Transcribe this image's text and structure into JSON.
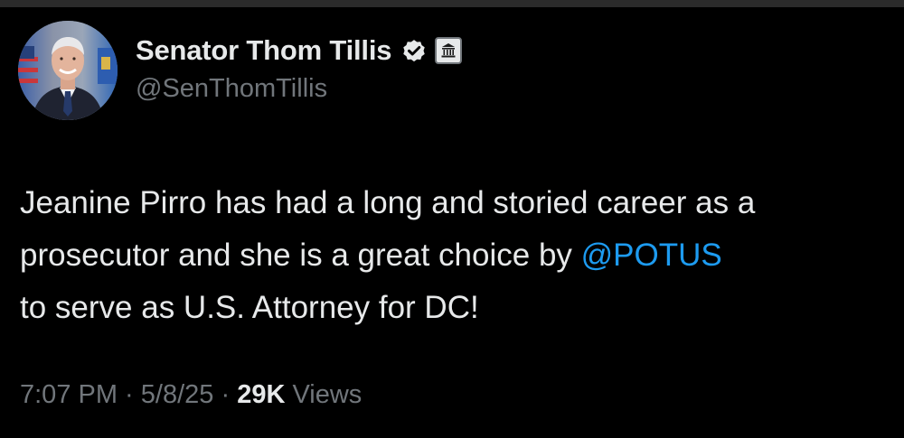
{
  "colors": {
    "background": "#000000",
    "text_primary": "#e7e9ea",
    "text_secondary": "#71767b",
    "mention": "#1d9bf0",
    "verified_badge": "#e7e9ea"
  },
  "author": {
    "display_name": "Senator Thom Tillis",
    "handle": "@SenThomTillis",
    "avatar_icon": "profile-photo",
    "verified_icon": "verified-badge-icon",
    "affiliation_icon": "government-building-icon"
  },
  "tweet": {
    "line1": "Jeanine Pirro has had a long and storied career as a",
    "line2_before": "prosecutor and she is a great choice by ",
    "mention": "@POTUS",
    "line3": "to serve as U.S. Attorney for DC!"
  },
  "meta": {
    "time": "7:07 PM",
    "separator": " · ",
    "date": "5/8/25",
    "views_count": "29K",
    "views_label": " Views"
  }
}
